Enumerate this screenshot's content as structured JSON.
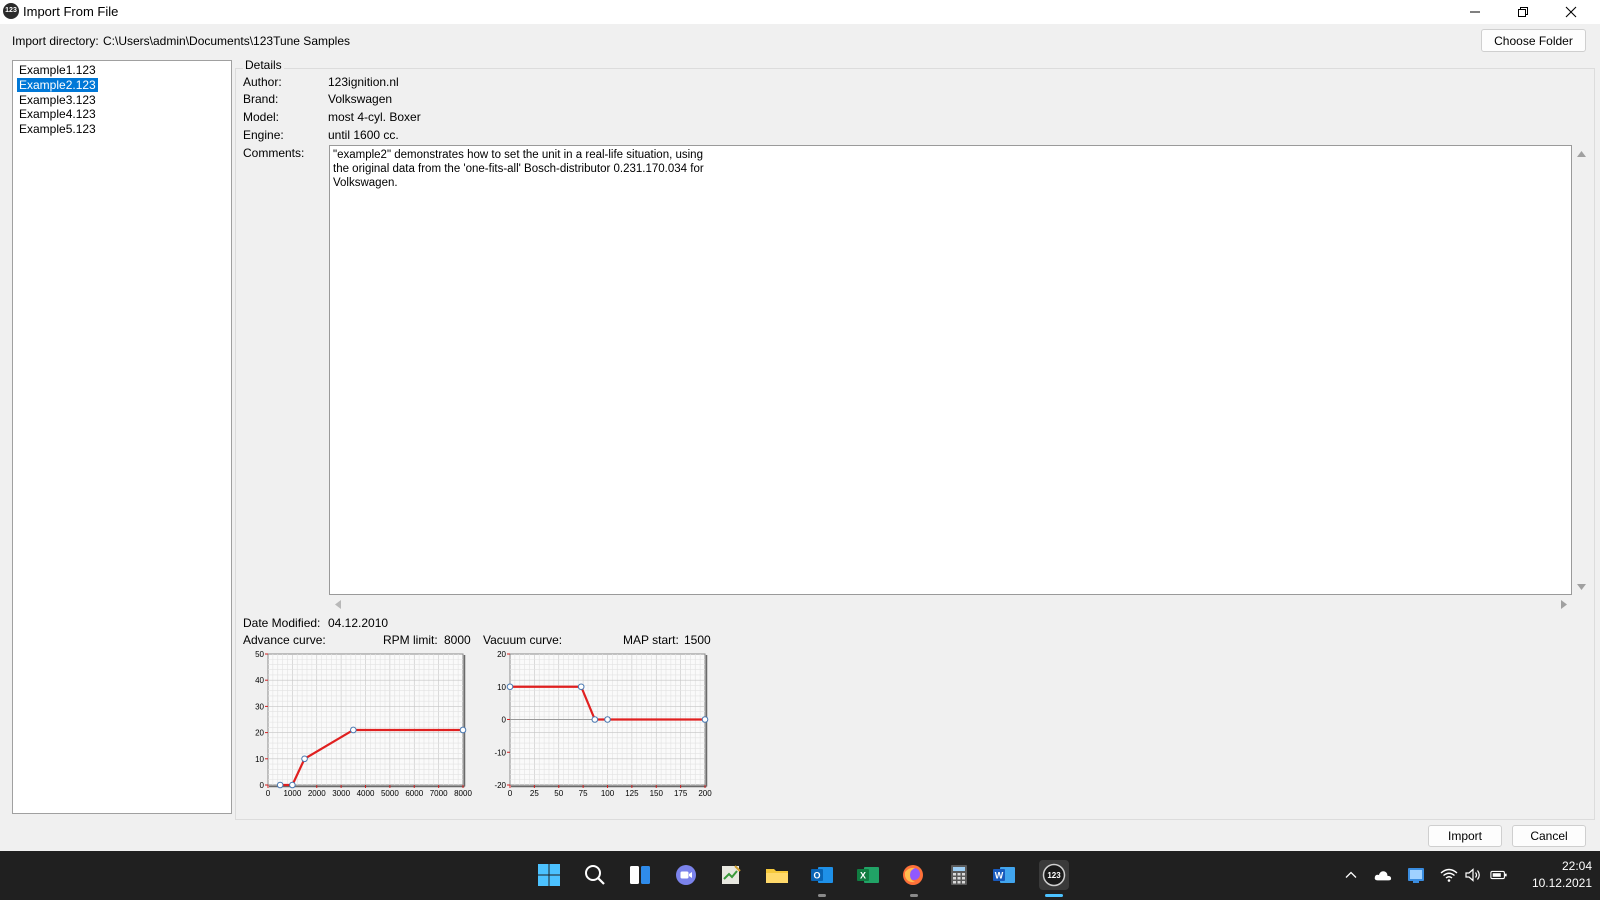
{
  "window": {
    "title": "Import From File",
    "app_icon_text": "123"
  },
  "import_directory": {
    "label": "Import directory:",
    "path": "C:\\Users\\admin\\Documents\\123Tune Samples",
    "choose_button": "Choose Folder"
  },
  "files": [
    {
      "name": "Example1.123",
      "selected": false
    },
    {
      "name": "Example2.123",
      "selected": true
    },
    {
      "name": "Example3.123",
      "selected": false
    },
    {
      "name": "Example4.123",
      "selected": false
    },
    {
      "name": "Example5.123",
      "selected": false
    }
  ],
  "details": {
    "legend": "Details",
    "author_label": "Author:",
    "author": "123ignition.nl",
    "brand_label": "Brand:",
    "brand": "Volkswagen",
    "model_label": "Model:",
    "model": "most 4-cyl. Boxer",
    "engine_label": "Engine:",
    "engine": "until 1600 cc.",
    "comments_label": "Comments:",
    "comments_lines": [
      "\"example2\" demonstrates how to set the unit in a real-life situation, using",
      "the original data from the 'one-fits-all' Bosch-distributor 0.231.170.034 for",
      "Volkswagen."
    ],
    "date_modified_label": "Date Modified:",
    "date_modified": "04.12.2010",
    "advance_curve_label": "Advance curve:",
    "rpm_limit_label": "RPM limit:",
    "rpm_limit": "8000",
    "vacuum_curve_label": "Vacuum curve:",
    "map_start_label": "MAP start:",
    "map_start": "1500"
  },
  "chart_data": [
    {
      "type": "line",
      "name": "advance-curve",
      "x": [
        500,
        1000,
        1500,
        3500,
        8000
      ],
      "y": [
        0,
        0,
        10,
        21,
        21
      ],
      "xlim": [
        0,
        8000
      ],
      "ylim": [
        0,
        50
      ],
      "xticks": [
        "0",
        "1000",
        "2000",
        "3000",
        "4000",
        "5000",
        "6000",
        "7000",
        "8000"
      ],
      "xtick_values": [
        0,
        1000,
        2000,
        3000,
        4000,
        5000,
        6000,
        7000,
        8000
      ],
      "yticks": [
        "0",
        "10",
        "20",
        "30",
        "40",
        "50"
      ],
      "ytick_values": [
        0,
        10,
        20,
        30,
        40,
        50
      ],
      "line_color": "#e02020",
      "grid": true
    },
    {
      "type": "line",
      "name": "vacuum-curve",
      "x": [
        0,
        73,
        87,
        100,
        200
      ],
      "y": [
        10,
        10,
        0,
        0,
        0
      ],
      "xlim": [
        0,
        200
      ],
      "ylim": [
        -20,
        20
      ],
      "xticks": [
        "0",
        "25",
        "50",
        "75",
        "100",
        "125",
        "150",
        "175",
        "200"
      ],
      "xtick_values": [
        0,
        25,
        50,
        75,
        100,
        125,
        150,
        175,
        200
      ],
      "yticks": [
        "20",
        "10",
        "0",
        "-10",
        "-20"
      ],
      "ytick_values": [
        20,
        10,
        0,
        -10,
        -20
      ],
      "line_color": "#e02020",
      "grid": true
    }
  ],
  "buttons": {
    "import": "Import",
    "cancel": "Cancel"
  },
  "taskbar": {
    "icons": [
      "windows-start-icon",
      "search-icon",
      "widgets-icon",
      "teams-chat-icon",
      "notepad-icon",
      "file-explorer-icon",
      "outlook-icon",
      "excel-icon",
      "firefox-icon",
      "calculator-icon",
      "word-icon",
      "123tune-icon"
    ],
    "tray": [
      "chevron-up-icon",
      "onedrive-icon",
      "network-app-icon",
      "wifi-icon",
      "volume-icon",
      "battery-icon"
    ],
    "time": "22:04",
    "date": "10.12.2021"
  },
  "colors": {
    "selection": "#0078d7",
    "taskbar": "#202020",
    "curve": "#e02020"
  }
}
